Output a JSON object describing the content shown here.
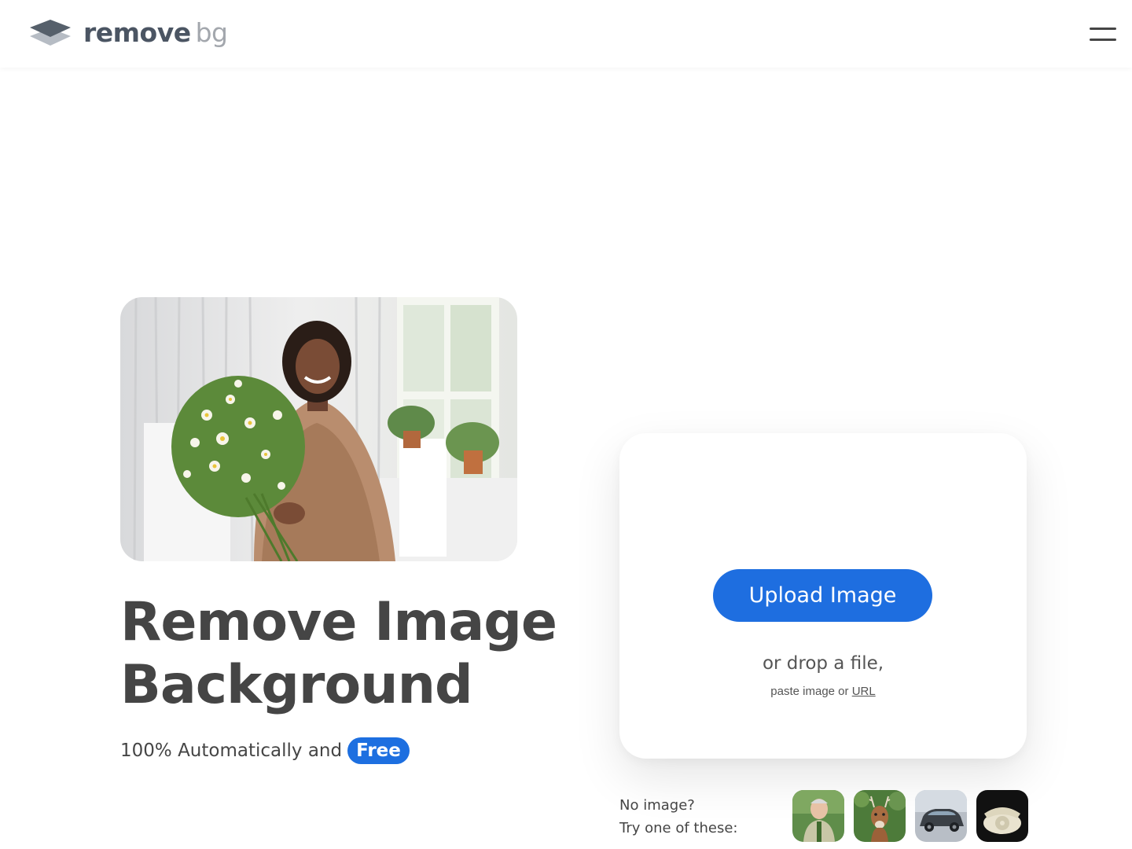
{
  "header": {
    "logo_remove": "remove",
    "logo_bg": "bg",
    "menu_icon": "hamburger-menu-icon"
  },
  "hero": {
    "headline_line1": "Remove Image",
    "headline_line2": "Background",
    "subline_text": "100% Automatically and",
    "free_badge": "Free",
    "photo_alt": "Woman holding a bouquet of chamomile flowers"
  },
  "upload": {
    "button_label": "Upload Image",
    "drop_text": "or drop a file,",
    "paste_prefix": "paste image or",
    "url_link": "URL"
  },
  "samples": {
    "line1": "No image?",
    "line2": "Try one of these:",
    "items": [
      {
        "name": "sample-person"
      },
      {
        "name": "sample-deer"
      },
      {
        "name": "sample-car"
      },
      {
        "name": "sample-telephone"
      }
    ]
  },
  "colors": {
    "accent": "#1e6ee0",
    "text": "#454545",
    "logo_secondary": "#a3a7ad"
  }
}
